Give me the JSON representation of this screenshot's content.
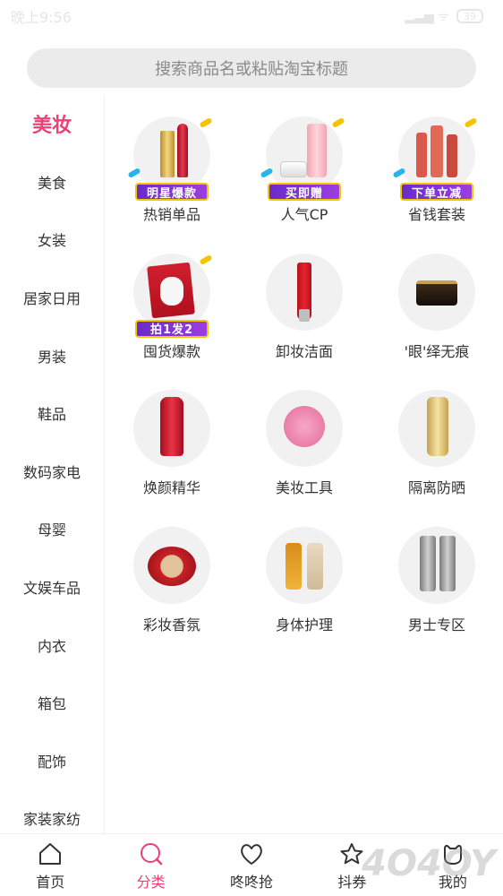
{
  "status": {
    "time": "晚上9:56",
    "battery": "39"
  },
  "search": {
    "placeholder": "搜索商品名或粘贴淘宝标题"
  },
  "sidebar": {
    "items": [
      {
        "label": "美妆"
      },
      {
        "label": "美食"
      },
      {
        "label": "女装"
      },
      {
        "label": "居家日用"
      },
      {
        "label": "男装"
      },
      {
        "label": "鞋品"
      },
      {
        "label": "数码家电"
      },
      {
        "label": "母婴"
      },
      {
        "label": "文娱车品"
      },
      {
        "label": "内衣"
      },
      {
        "label": "箱包"
      },
      {
        "label": "配饰"
      },
      {
        "label": "家装家纺"
      }
    ]
  },
  "grid": {
    "items": [
      {
        "label": "热销单品",
        "badge": "明星爆款",
        "icon": "lipstick-icon"
      },
      {
        "label": "人气CP",
        "badge": "买即赠",
        "icon": "lotion-set-icon"
      },
      {
        "label": "省钱套装",
        "badge": "下单立减",
        "icon": "skincare-set-icon"
      },
      {
        "label": "囤货爆款",
        "badge": "拍1发2",
        "icon": "face-mask-icon"
      },
      {
        "label": "卸妆洁面",
        "badge": "",
        "icon": "cleanser-tube-icon"
      },
      {
        "label": "'眼'绎无痕",
        "badge": "",
        "icon": "eye-cream-icon"
      },
      {
        "label": "焕颜精华",
        "badge": "",
        "icon": "serum-bottle-icon"
      },
      {
        "label": "美妆工具",
        "badge": "",
        "icon": "cleansing-brush-icon"
      },
      {
        "label": "隔离防晒",
        "badge": "",
        "icon": "sunscreen-icon"
      },
      {
        "label": "彩妆香氛",
        "badge": "",
        "icon": "cushion-compact-icon"
      },
      {
        "label": "身体护理",
        "badge": "",
        "icon": "body-oil-icon"
      },
      {
        "label": "男士专区",
        "badge": "",
        "icon": "mens-care-icon"
      }
    ]
  },
  "tabbar": {
    "items": [
      {
        "label": "首页"
      },
      {
        "label": "分类"
      },
      {
        "label": "咚咚抢"
      },
      {
        "label": "抖券"
      },
      {
        "label": "我的"
      }
    ]
  },
  "colors": {
    "accent": "#ef3f76",
    "badge": "#7b31d2",
    "badge_border": "#f5c400"
  }
}
